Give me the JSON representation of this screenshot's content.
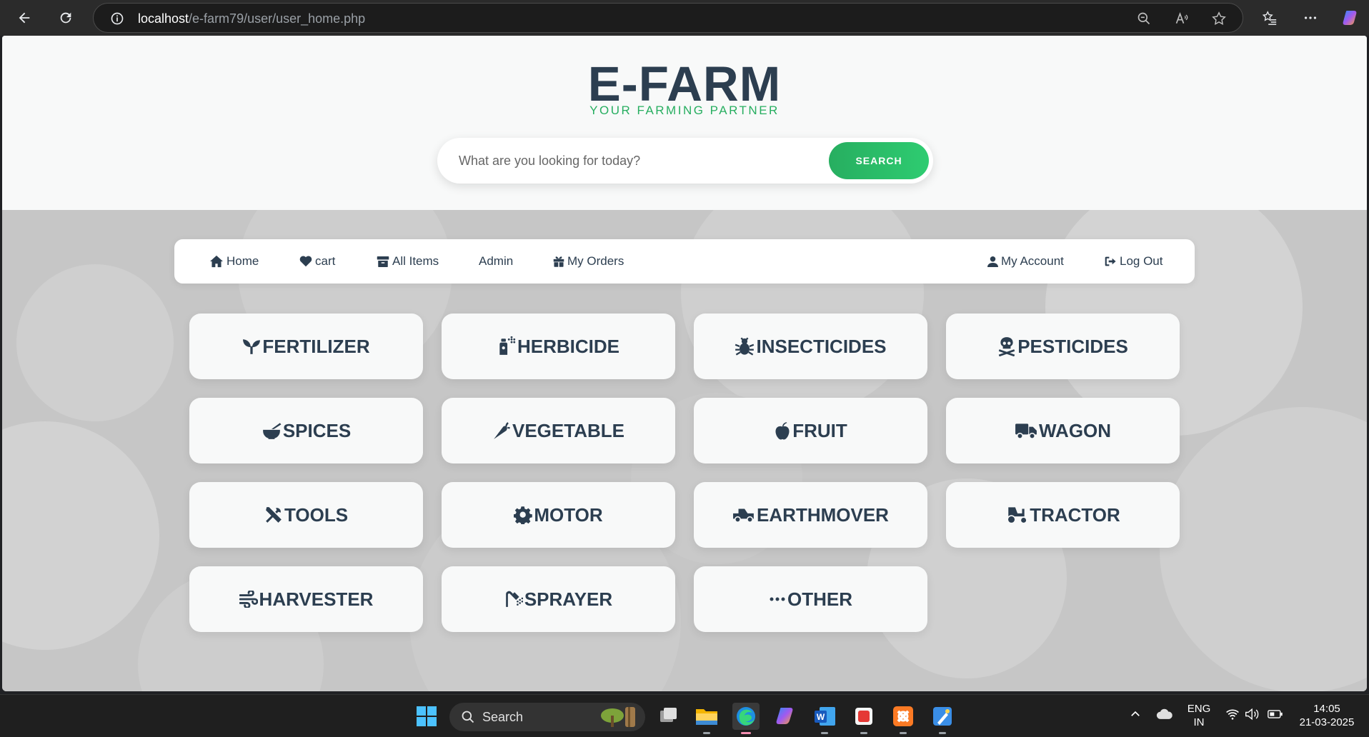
{
  "browser": {
    "url_host": "localhost",
    "url_path": "/e-farm79/user/user_home.php",
    "icons": [
      "back-arrow-icon",
      "refresh-icon",
      "info-icon",
      "zoom-out-icon",
      "read-aloud-icon",
      "favorite-star-icon",
      "favorites-list-icon",
      "more-icon",
      "copilot-icon"
    ]
  },
  "header": {
    "title": "E-FARM",
    "tagline": "YOUR FARMING PARTNER",
    "search_placeholder": "What are you looking for today?",
    "search_button": "SEARCH",
    "colors": {
      "title": "#2c3e50",
      "accent": "#27ae60"
    }
  },
  "nav": {
    "home": {
      "label": "Home",
      "icon": "home-icon"
    },
    "cart": {
      "label": "cart",
      "icon": "heart-icon"
    },
    "all_items": {
      "label": "All Items",
      "icon": "box-archive-icon"
    },
    "admin": {
      "label": "Admin"
    },
    "my_orders": {
      "label": "My Orders",
      "icon": "gift-icon"
    },
    "my_account": {
      "label": "My Account",
      "icon": "user-icon"
    },
    "log_out": {
      "label": "Log Out",
      "icon": "logout-icon"
    }
  },
  "categories": [
    {
      "label": "FERTILIZER",
      "icon": "seedling-icon"
    },
    {
      "label": "HERBICIDE",
      "icon": "spray-can-icon"
    },
    {
      "label": "INSECTICIDES",
      "icon": "bug-icon"
    },
    {
      "label": "PESTICIDES",
      "icon": "skull-crossbones-icon"
    },
    {
      "label": "SPICES",
      "icon": "mortar-pestle-icon"
    },
    {
      "label": "VEGETABLE",
      "icon": "carrot-icon"
    },
    {
      "label": "FRUIT",
      "icon": "apple-icon"
    },
    {
      "label": "WAGON",
      "icon": "truck-icon"
    },
    {
      "label": "TOOLS",
      "icon": "tools-icon"
    },
    {
      "label": "MOTOR",
      "icon": "gear-icon"
    },
    {
      "label": "EARTHMOVER",
      "icon": "truck-pickup-icon"
    },
    {
      "label": "TRACTOR",
      "icon": "tractor-icon"
    },
    {
      "label": "HARVESTER",
      "icon": "wind-icon"
    },
    {
      "label": "SPRAYER",
      "icon": "shower-icon"
    },
    {
      "label": "OTHER",
      "icon": "ellipsis-icon"
    }
  ],
  "taskbar": {
    "search_label": "Search",
    "apps": [
      "windows-start-icon",
      "task-view-icon",
      "file-explorer-icon",
      "edge-icon",
      "copilot-app-icon",
      "word-icon",
      "red-app-icon",
      "xampp-icon",
      "paint-icon"
    ],
    "tray": {
      "lang_line1": "ENG",
      "lang_line2": "IN",
      "time": "14:05",
      "date": "21-03-2025"
    }
  }
}
